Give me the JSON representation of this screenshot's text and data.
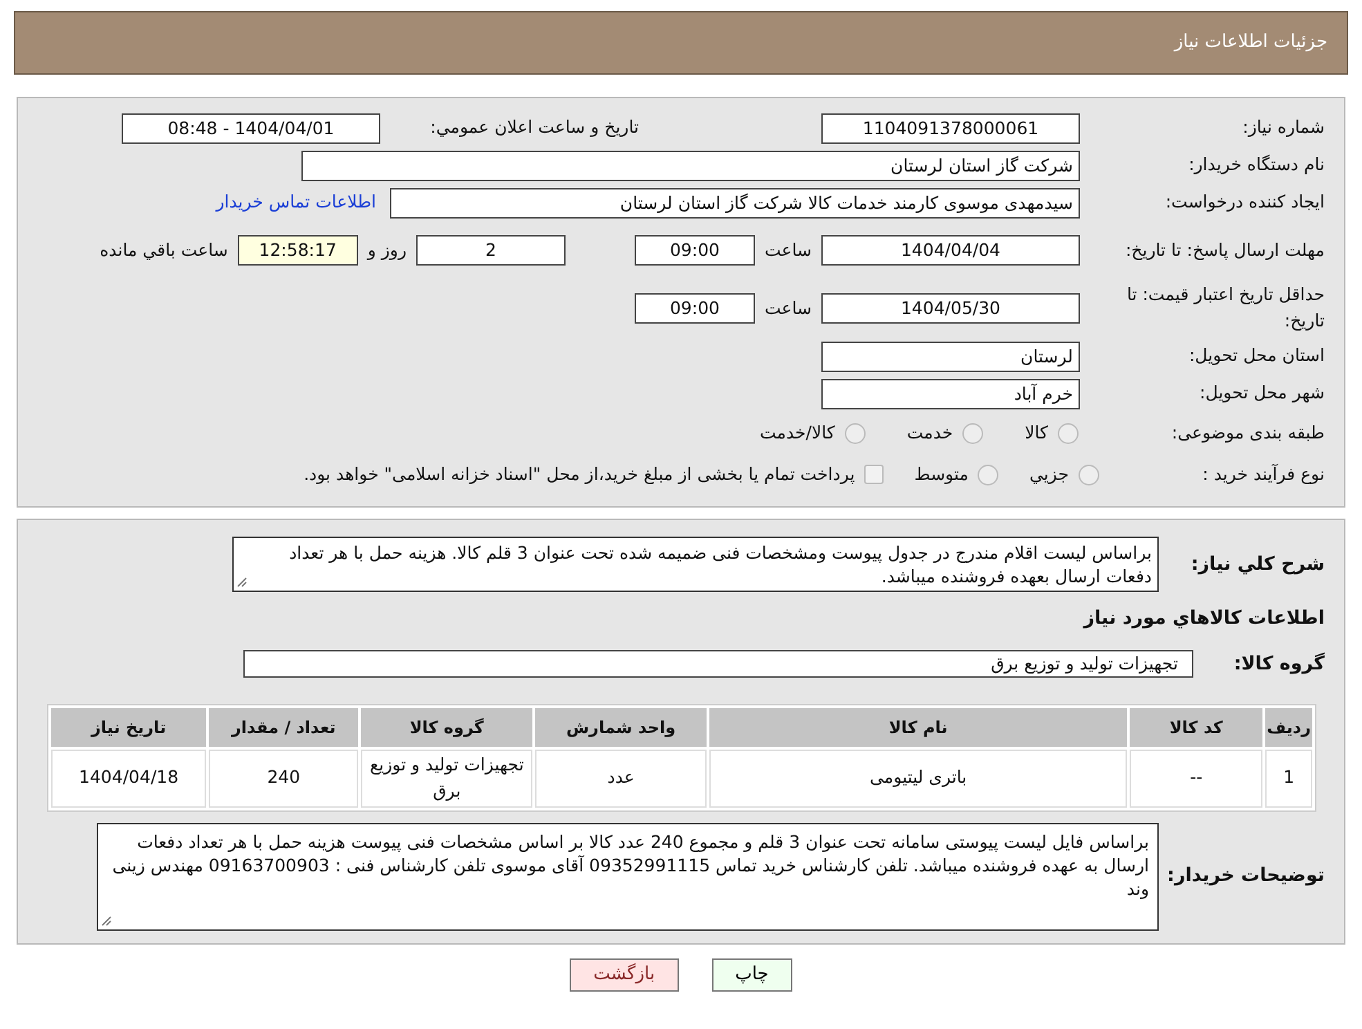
{
  "header": {
    "title": "جزئیات اطلاعات نیاز"
  },
  "need_number": {
    "label": "شماره نیاز:",
    "value": "1104091378000061"
  },
  "announce": {
    "label": "تاریخ و ساعت اعلان عمومي:",
    "value": "1404/04/01 - 08:48"
  },
  "buyer": {
    "label": "نام دستگاه خريدار:",
    "value": "شرکت گاز استان لرستان"
  },
  "creator": {
    "label": "ايجاد کننده درخواست:",
    "value": "سیدمهدی موسوی کارمند خدمات کالا شرکت گاز استان لرستان",
    "link": "اطلاعات تماس خريدار"
  },
  "deadline": {
    "label": "مهلت ارسال پاسخ: تا تاریخ:",
    "date": "1404/04/04",
    "time_label": "ساعت",
    "time": "09:00",
    "days": "2",
    "days_label": "روز و",
    "remaining": "12:58:17",
    "remaining_label": "ساعت باقي مانده"
  },
  "validity": {
    "label": "حداقل تاریخ اعتبار قیمت: تا تاریخ:",
    "date": "1404/05/30",
    "time_label": "ساعت",
    "time": "09:00"
  },
  "province": {
    "label": "استان محل تحویل:",
    "value": "لرستان"
  },
  "city": {
    "label": "شهر محل تحویل:",
    "value": "خرم آباد"
  },
  "category": {
    "label": "طبقه بندی موضوعی:",
    "options": [
      {
        "label": "کالا",
        "selected": false
      },
      {
        "label": "خدمت",
        "selected": false
      },
      {
        "label": "کالا/خدمت",
        "selected": false
      }
    ]
  },
  "process": {
    "label": "نوع فرآیند خرید :",
    "options": [
      {
        "label": "جزيي",
        "selected": false
      },
      {
        "label": "متوسط",
        "selected": false
      }
    ],
    "treasury": {
      "label": "پرداخت تمام یا بخشی از مبلغ خرید،از محل \"اسناد خزانه اسلامی\" خواهد بود.",
      "checked": false
    }
  },
  "description": {
    "label": "شرح کلي نياز:",
    "text": "براساس لیست اقلام مندرج در جدول پیوست ومشخصات فنی ضمیمه شده تحت عنوان 3 قلم کالا. هزینه حمل با هر تعداد دفعات ارسال بعهده فروشنده میباشد."
  },
  "goods_title": "اطلاعات کالاهاي مورد نياز",
  "goods_group": {
    "label": "گروه کالا:",
    "value": "تجهیزات تولید و توزیع برق"
  },
  "table": {
    "columns": [
      "ردیف",
      "کد کالا",
      "نام کالا",
      "واحد شمارش",
      "گروه کالا",
      "تعداد / مقدار",
      "تاریخ نیاز"
    ],
    "rows": [
      [
        "1",
        "--",
        "باتری لیتیومی",
        "عدد",
        "تجهیزات تولید و توزیع برق",
        "240",
        "1404/04/18"
      ]
    ]
  },
  "buyer_notes": {
    "label": "توضیحات خریدار:",
    "text": "براساس  فایل لیست پیوستی سامانه تحت عنوان 3 قلم و مجموع 240 عدد کالا بر اساس مشخصات فنی پیوست هزینه حمل با هر تعداد دفعات ارسال به عهده فروشنده میباشد. تلفن کارشناس خرید تماس 09352991115 آقای موسوی تلفن کارشناس فنی : 09163700903 مهندس زینی وند"
  },
  "buttons": [
    {
      "label": "چاپ",
      "kind": "print"
    },
    {
      "label": "بازگشت",
      "kind": "back"
    }
  ]
}
